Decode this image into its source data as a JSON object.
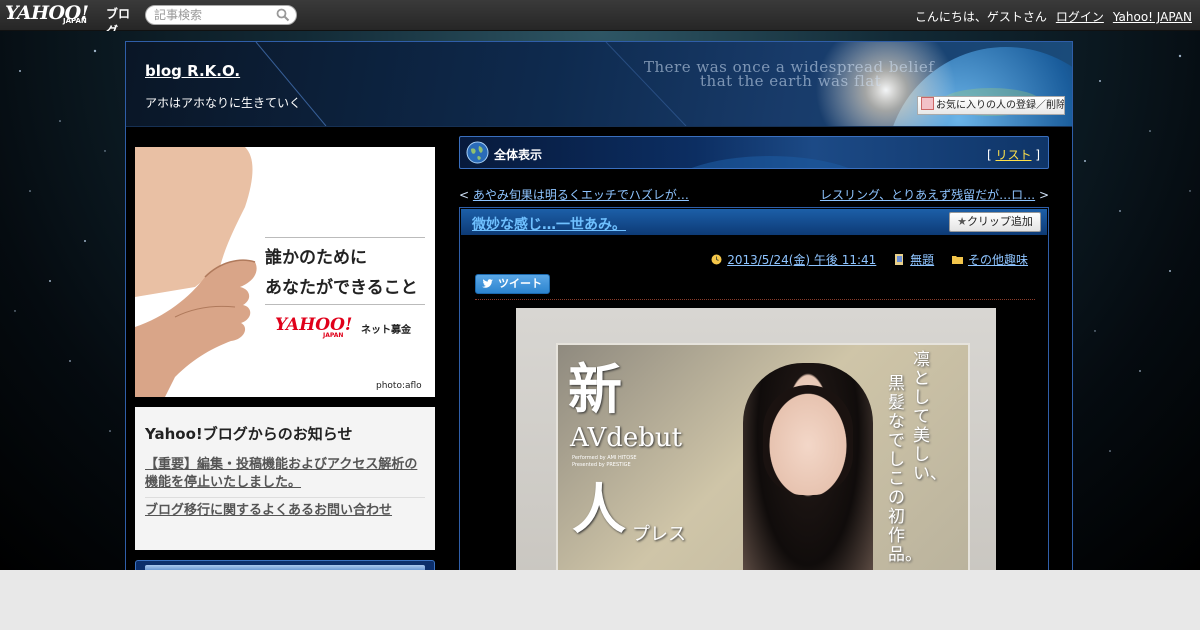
{
  "topbar": {
    "logo_main": "YAHOO!",
    "logo_sub": "JAPAN",
    "logo_service": "ブログ",
    "search_placeholder": "記事検索",
    "greeting": "こんにちは、ゲストさん",
    "login_link": "ログイン",
    "yahoo_japan_link": "Yahoo! JAPAN"
  },
  "header": {
    "blog_title": "blog R.K.O.",
    "blog_description": "アホはアホなりに生きていく",
    "banner_quote_line1": "There was once a widespread belief",
    "banner_quote_line2": "that the earth was flat",
    "favorite_button": "お気に入りの人の登録／削除"
  },
  "ad": {
    "copy_line1": "誰かのために",
    "copy_line2": "あなたができること",
    "brand": "YAHOO!",
    "brand_sub": "JAPAN",
    "service": "ネット募金",
    "credit": "photo:aflo"
  },
  "notice": {
    "title": "Yahoo!ブログからのお知らせ",
    "links": [
      "【重要】編集・投稿機能およびアクセス解析の機能を停止いたしました。",
      "ブログ移行に関するよくあるお問い合わせ"
    ]
  },
  "main": {
    "section_title": "全体表示",
    "list_label": "リスト",
    "prev_post": "あやみ旬果は明るくエッチでハズレが…",
    "next_post": "レスリング、とりあえず残留だが…ロ…",
    "post": {
      "title": "微妙な感じ…一世あみ。",
      "clip_button": "クリップ追加",
      "date": "2013/5/24(金) 午後 11:41",
      "theme": "無題",
      "category": "その他趣味",
      "tweet_button": "ツイート"
    }
  },
  "photo_text": {
    "big1": "新",
    "big2": "人",
    "avdebut": "AVdebut",
    "performed": "Performed by AMI HITOSE",
    "presented": "Presented by PRESTIGE",
    "tagline_col1": "凛として美しい、",
    "tagline_col2": "黒髪なでしこの初作品。",
    "label_bottom": "プレス"
  },
  "colors": {
    "frame_border": "#2f5ea8",
    "link_blue": "#8ec4ff",
    "list_yellow": "#ffe14a",
    "post_title": "#6fc0ff",
    "brand_red": "#e0001a"
  }
}
